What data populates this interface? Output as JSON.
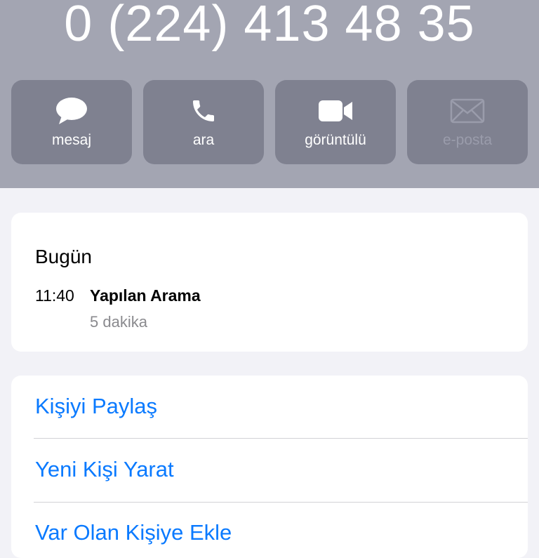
{
  "header": {
    "phone_number": "0 (224) 413 48 35",
    "actions": [
      {
        "label": "mesaj",
        "icon": "message-icon",
        "enabled": true
      },
      {
        "label": "ara",
        "icon": "phone-icon",
        "enabled": true
      },
      {
        "label": "görüntülü",
        "icon": "video-icon",
        "enabled": true
      },
      {
        "label": "e-posta",
        "icon": "mail-icon",
        "enabled": false
      }
    ]
  },
  "recents": {
    "day": "Bugün",
    "time": "11:40",
    "call_type": "Yapılan Arama",
    "duration": "5 dakika"
  },
  "options": [
    {
      "label": "Kişiyi Paylaş"
    },
    {
      "label": "Yeni Kişi Yarat"
    },
    {
      "label": "Var Olan Kişiye Ekle"
    }
  ],
  "colors": {
    "header_bg": "#a3a5b2",
    "button_bg": "#7f8190",
    "link": "#0a7aff",
    "page_bg": "#f2f2f7"
  }
}
